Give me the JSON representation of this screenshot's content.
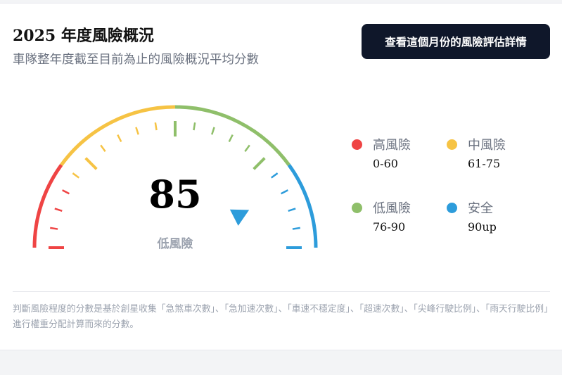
{
  "header": {
    "title": "2025 年度風險概況",
    "subtitle": "車隊整年度截至目前為止的風險概況平均分數",
    "detail_button": "查看這個月份的風險評估詳情"
  },
  "gauge": {
    "score": 85,
    "score_text": "85",
    "level_label": "低風險",
    "min": 0,
    "max": 100
  },
  "legend": [
    {
      "name": "高風險",
      "range": "0-60",
      "color": "#ef4444"
    },
    {
      "name": "中風險",
      "range": "61-75",
      "color": "#f6c344"
    },
    {
      "name": "低風險",
      "range": "76-90",
      "color": "#8fbf6a"
    },
    {
      "name": "安全",
      "range": "90up",
      "color": "#2d9cdb"
    }
  ],
  "colors": {
    "high": "#ef4444",
    "medium": "#f6c344",
    "low": "#8fbf6a",
    "safe": "#2d9cdb",
    "button_bg": "#0f172a"
  },
  "footnote": "判斷風險程度的分數是基於創星收集「急煞車次數」、「急加速次數」、「車速不穩定度」、「超速次數」、「尖峰行駛比例」、「雨天行駛比例」進行權重分配計算而來的分數。"
}
